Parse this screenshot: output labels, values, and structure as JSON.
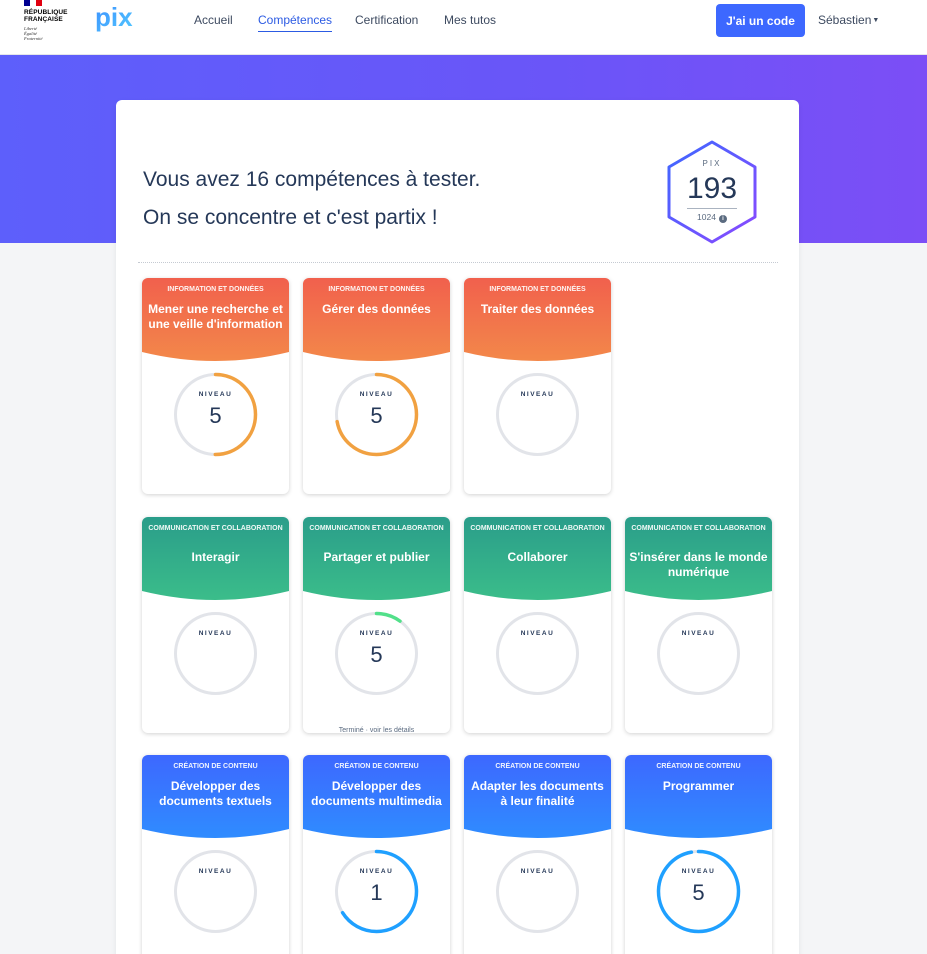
{
  "header": {
    "republique": {
      "line1": "RÉPUBLIQUE",
      "line2": "FRANÇAISE",
      "motto": [
        "Liberté",
        "Égalité",
        "Fraternité"
      ]
    },
    "logo_text": "pix",
    "nav": [
      {
        "label": "Accueil",
        "active": false
      },
      {
        "label": "Compétences",
        "active": true
      },
      {
        "label": "Certification",
        "active": false
      },
      {
        "label": "Mes tutos",
        "active": false
      }
    ],
    "code_button": "J'ai un code",
    "user_name": "Sébastien"
  },
  "hero": {
    "title_line1": "Vous avez 16 compétences à tester.",
    "title_line2": "On se concentre et c'est partix !"
  },
  "score": {
    "label": "PIX",
    "value": "193",
    "max": "1024"
  },
  "colors": {
    "accent": "#3d68ff",
    "info_start": "#f1604d",
    "info_end": "#f3884a",
    "info_ring": "#f1a141",
    "comm_start": "#2a9d8a",
    "comm_end": "#3bbd8a",
    "comm_ring": "#52e08a",
    "crea_start": "#3d68ff",
    "crea_end": "#2f8cff",
    "crea_ring": "#1fa0ff",
    "ring_track": "#e2e4e9"
  },
  "levelLabel": "NIVEAU",
  "cards": [
    {
      "area": "INFORMATION ET DONNÉES",
      "name": "Mener une recherche et une veille d'information",
      "level": "5",
      "progress": 0.5,
      "theme": "info",
      "foot": ""
    },
    {
      "area": "INFORMATION ET DONNÉES",
      "name": "Gérer des données",
      "level": "5",
      "progress": 0.72,
      "theme": "info",
      "foot": ""
    },
    {
      "area": "INFORMATION ET DONNÉES",
      "name": "Traiter des données",
      "level": "",
      "progress": 0,
      "theme": "info",
      "foot": ""
    },
    {
      "area": "COMMUNICATION ET COLLABORATION",
      "name": "Interagir",
      "level": "",
      "progress": 0,
      "theme": "comm",
      "foot": ""
    },
    {
      "area": "COMMUNICATION ET COLLABORATION",
      "name": "Partager et publier",
      "level": "5",
      "progress": 0.1,
      "theme": "comm",
      "foot": "Terminé · voir les détails"
    },
    {
      "area": "COMMUNICATION ET COLLABORATION",
      "name": "Collaborer",
      "level": "",
      "progress": 0,
      "theme": "comm",
      "foot": ""
    },
    {
      "area": "COMMUNICATION ET COLLABORATION",
      "name": "S'insérer dans le monde numérique",
      "level": "",
      "progress": 0,
      "theme": "comm",
      "foot": ""
    },
    {
      "area": "CRÉATION DE CONTENU",
      "name": "Développer des documents textuels",
      "level": "",
      "progress": 0,
      "theme": "crea",
      "foot": ""
    },
    {
      "area": "CRÉATION DE CONTENU",
      "name": "Développer des documents multimedia",
      "level": "1",
      "progress": 0.66,
      "theme": "crea",
      "foot": ""
    },
    {
      "area": "CRÉATION DE CONTENU",
      "name": "Adapter les documents à leur finalité",
      "level": "",
      "progress": 0,
      "theme": "crea",
      "foot": ""
    },
    {
      "area": "CRÉATION DE CONTENU",
      "name": "Programmer",
      "level": "5",
      "progress": 0.97,
      "theme": "crea",
      "foot": ""
    }
  ]
}
